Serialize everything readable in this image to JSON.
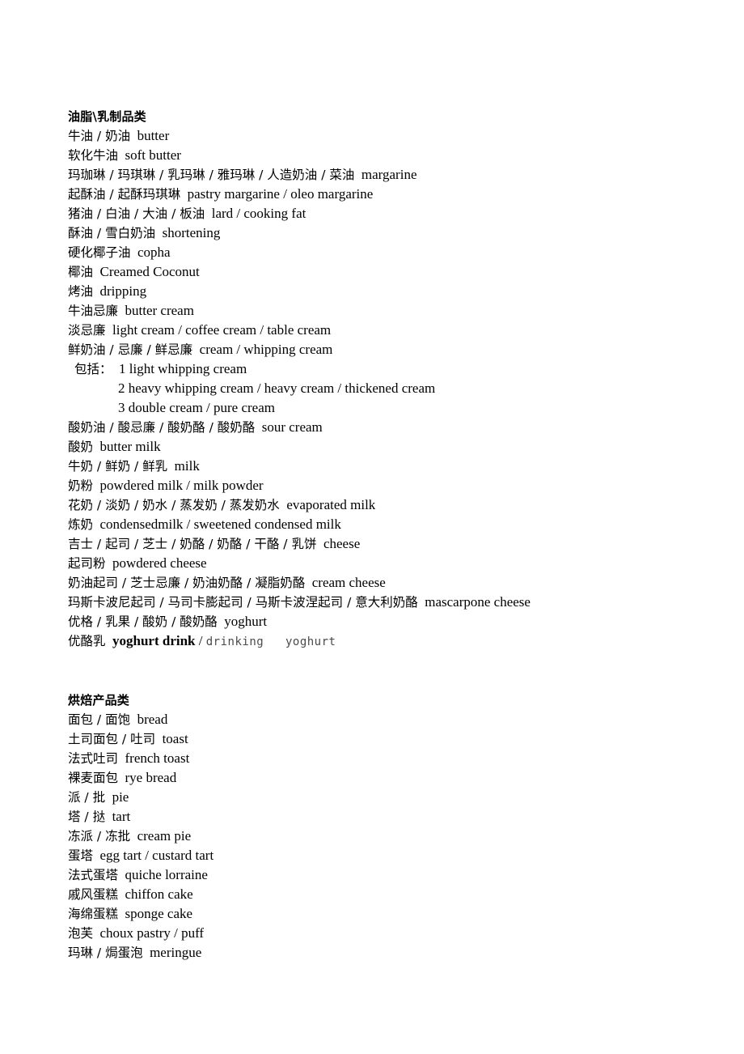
{
  "document": {
    "sections": [
      {
        "heading": "油脂\\乳制品类",
        "entries": [
          {
            "cn": "牛油 / 奶油",
            "en": "butter"
          },
          {
            "cn": "软化牛油",
            "en": "soft butter"
          },
          {
            "cn": "玛珈琳 / 玛琪琳 / 乳玛琳 / 雅玛琳 / 人造奶油 / 菜油",
            "en": "margarine"
          },
          {
            "cn": "起酥油 / 起酥玛琪琳",
            "en": "pastry margarine / oleo margarine"
          },
          {
            "cn": "猪油 / 白油 / 大油 / 板油",
            "en": "lard / cooking fat"
          },
          {
            "cn": "酥油 / 雪白奶油",
            "en": "shortening"
          },
          {
            "cn": "硬化椰子油",
            "en": "copha"
          },
          {
            "cn": "椰油",
            "en": "Creamed Coconut"
          },
          {
            "cn": "烤油",
            "en": "dripping"
          },
          {
            "cn": "牛油忌廉",
            "en": "butter cream"
          },
          {
            "cn": "淡忌廉",
            "en": "light cream / coffee cream / table cream"
          },
          {
            "cn": "鲜奶油 / 忌廉 / 鲜忌廉",
            "en": "cream / whipping cream"
          },
          {
            "cn": "包括：",
            "en": "1 light whipping cream",
            "style": "sub-head"
          },
          {
            "cn": "",
            "en": "2 heavy whipping cream / heavy cream / thickened cream",
            "style": "sub-item"
          },
          {
            "cn": "",
            "en": "3 double cream / pure cream",
            "style": "sub-item"
          },
          {
            "cn": "酸奶油 / 酸忌廉 / 酸奶酪 / 酸奶酪",
            "en": "sour cream"
          },
          {
            "cn": "酸奶",
            "en": "butter milk"
          },
          {
            "cn": "牛奶 / 鲜奶 / 鲜乳",
            "en": "milk"
          },
          {
            "cn": "奶粉",
            "en": "powdered milk / milk powder"
          },
          {
            "cn": "花奶 / 淡奶 / 奶水 / 蒸发奶 / 蒸发奶水",
            "en": "evaporated milk"
          },
          {
            "cn": "炼奶",
            "en": "condensedmilk / sweetened condensed milk"
          },
          {
            "cn": "吉士 / 起司 / 芝士 / 奶酪 / 奶酪 / 干酪 / 乳饼",
            "en": "cheese"
          },
          {
            "cn": "起司粉",
            "en": "powdered cheese"
          },
          {
            "cn": "奶油起司 / 芝士忌廉 / 奶油奶酪 / 凝脂奶酪",
            "en": "cream cheese"
          },
          {
            "cn": "玛斯卡波尼起司 / 马司卡膨起司 / 马斯卡波涅起司 / 意大利奶酪",
            "en": "mascarpone cheese"
          },
          {
            "cn": "优格 / 乳果 / 酸奶 / 酸奶酪",
            "en": "yoghurt"
          },
          {
            "cn": "优酪乳",
            "en_bold": "yoghurt drink",
            "en_sep": " / ",
            "en_mono": "drinking   yoghurt",
            "style": "mixed"
          }
        ]
      },
      {
        "heading": "烘焙产品类",
        "entries": [
          {
            "cn": "面包 / 面饱",
            "en": "bread"
          },
          {
            "cn": "土司面包 / 吐司",
            "en": "toast"
          },
          {
            "cn": "法式吐司",
            "en": "french toast"
          },
          {
            "cn": "裸麦面包",
            "en": "rye bread"
          },
          {
            "cn": "派 / 批",
            "en": "pie"
          },
          {
            "cn": "塔 / 挞",
            "en": "tart"
          },
          {
            "cn": "冻派 / 冻批",
            "en": "cream pie"
          },
          {
            "cn": "蛋塔",
            "en": "egg tart / custard tart"
          },
          {
            "cn": "法式蛋塔",
            "en": "quiche lorraine"
          },
          {
            "cn": "戚风蛋糕",
            "en": "chiffon cake"
          },
          {
            "cn": "海绵蛋糕",
            "en": "sponge cake"
          },
          {
            "cn": "泡芙",
            "en": "choux pastry / puff"
          },
          {
            "cn": "玛琳 / 焗蛋泡",
            "en": "meringue"
          }
        ]
      }
    ]
  }
}
